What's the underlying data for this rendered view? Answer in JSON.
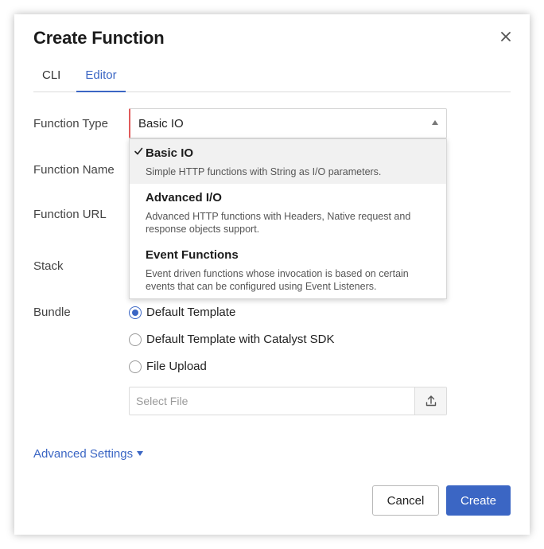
{
  "dialog": {
    "title": "Create Function",
    "close_icon": "close-icon"
  },
  "tabs": [
    {
      "label": "CLI",
      "active": false
    },
    {
      "label": "Editor",
      "active": true
    }
  ],
  "form": {
    "function_type_label": "Function Type",
    "function_name_label": "Function Name",
    "function_url_label": "Function URL",
    "stack_label": "Stack",
    "bundle_label": "Bundle"
  },
  "function_type_select": {
    "value": "Basic IO",
    "expanded": true,
    "options": [
      {
        "title": "Basic IO",
        "description": "Simple HTTP functions with String as I/O parameters.",
        "selected": true
      },
      {
        "title": "Advanced I/O",
        "description": "Advanced HTTP functions with Headers, Native request and response objects support.",
        "selected": false
      },
      {
        "title": "Event Functions",
        "description": "Event driven functions whose invocation is based on certain events that can be configured using Event Listeners.",
        "selected": false
      }
    ]
  },
  "bundle": {
    "options": [
      {
        "label": "Default Template",
        "checked": true
      },
      {
        "label": "Default Template with Catalyst SDK",
        "checked": false
      },
      {
        "label": "File Upload",
        "checked": false
      }
    ],
    "file_placeholder": "Select File",
    "upload_icon": "upload-icon"
  },
  "advanced_settings_label": "Advanced Settings",
  "buttons": {
    "cancel": "Cancel",
    "create": "Create"
  },
  "colors": {
    "accent": "#3b66c4",
    "error_border": "#e05b5b"
  }
}
